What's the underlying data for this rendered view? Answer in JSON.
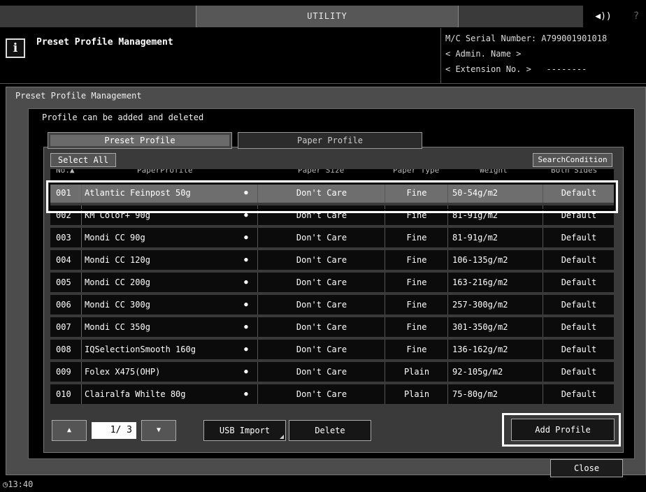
{
  "titlebar": {
    "title": "UTILITY",
    "speaker_glyph": "◀))",
    "help_glyph": "?"
  },
  "header": {
    "icon_letter": "i",
    "title": "Preset Profile Management",
    "serial": "M/C Serial Number: A799001901018",
    "admin": "< Admin. Name >",
    "extension": "< Extension No. >   --------"
  },
  "breadcrumb": "Preset Profile Management",
  "instruction": "Profile can be added and deleted",
  "tabs": {
    "preset": "Preset Profile",
    "paper": "Paper Profile"
  },
  "buttons": {
    "select_all": "Select All",
    "search_condition": "SearchCondition",
    "usb_import": "USB Import",
    "delete": "Delete",
    "add_profile": "Add Profile",
    "close": "Close",
    "up": "▲",
    "down": "▼"
  },
  "pagination": {
    "current": "1/",
    "total": "3"
  },
  "table": {
    "headers": {
      "no": "No.▲",
      "paper_profile": "PaperProfile",
      "paper_size": "Paper Size",
      "paper_type": "Paper Type",
      "weight": "Weight",
      "both_sides": "Both Sides"
    },
    "rows": [
      {
        "no": "001",
        "name": "Atlantic Feinpost 50g",
        "dot": "●",
        "size": "Don't Care",
        "type": "Fine",
        "weight": "50-54g/m2",
        "both": "Default"
      },
      {
        "no": "002",
        "name": "KM Color+ 90g",
        "dot": "●",
        "size": "Don't Care",
        "type": "Fine",
        "weight": "81-91g/m2",
        "both": "Default"
      },
      {
        "no": "003",
        "name": "Mondi CC 90g",
        "dot": "●",
        "size": "Don't Care",
        "type": "Fine",
        "weight": "81-91g/m2",
        "both": "Default"
      },
      {
        "no": "004",
        "name": "Mondi CC 120g",
        "dot": "●",
        "size": "Don't Care",
        "type": "Fine",
        "weight": "106-135g/m2",
        "both": "Default"
      },
      {
        "no": "005",
        "name": "Mondi CC 200g",
        "dot": "●",
        "size": "Don't Care",
        "type": "Fine",
        "weight": "163-216g/m2",
        "both": "Default"
      },
      {
        "no": "006",
        "name": "Mondi CC 300g",
        "dot": "●",
        "size": "Don't Care",
        "type": "Fine",
        "weight": "257-300g/m2",
        "both": "Default"
      },
      {
        "no": "007",
        "name": "Mondi CC 350g",
        "dot": "●",
        "size": "Don't Care",
        "type": "Fine",
        "weight": "301-350g/m2",
        "both": "Default"
      },
      {
        "no": "008",
        "name": "IQSelectionSmooth 160g",
        "dot": "●",
        "size": "Don't Care",
        "type": "Fine",
        "weight": "136-162g/m2",
        "both": "Default"
      },
      {
        "no": "009",
        "name": "Folex X475(OHP)",
        "dot": "●",
        "size": "Don't Care",
        "type": "Plain",
        "weight": "92-105g/m2",
        "both": "Default"
      },
      {
        "no": "010",
        "name": "Clairalfa Whilte 80g",
        "dot": "●",
        "size": "Don't Care",
        "type": "Plain",
        "weight": "75-80g/m2",
        "both": "Default"
      }
    ],
    "selected_index": 0
  },
  "clock": "◷13:40"
}
